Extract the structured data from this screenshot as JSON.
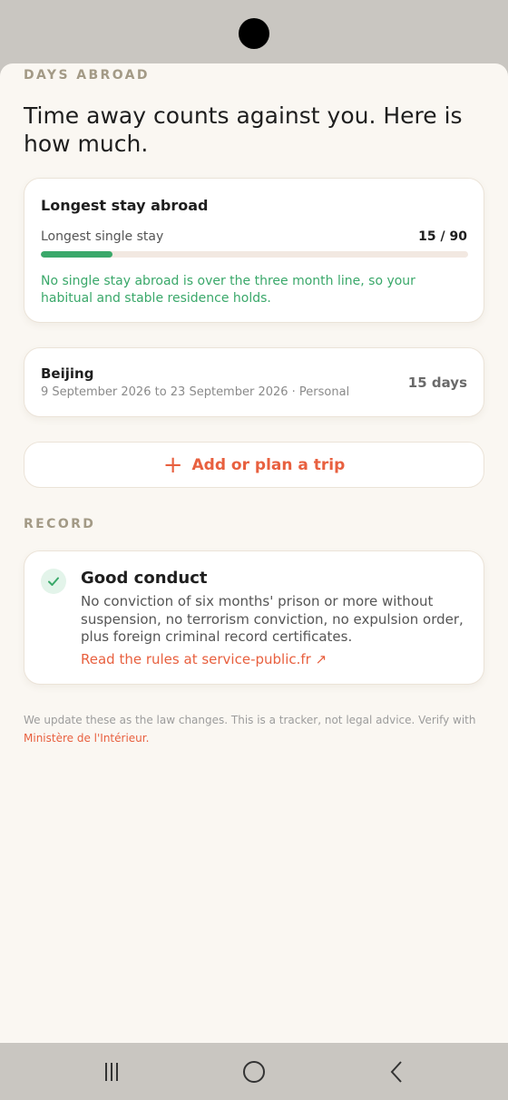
{
  "sections": {
    "days_abroad": "DAYS ABROAD",
    "record": "RECORD"
  },
  "headline": "Time away counts against you. Here is how much.",
  "longest_stay": {
    "title": "Longest stay abroad",
    "label": "Longest single stay",
    "count": "15 / 90",
    "progress_fraction": 0.1667,
    "note": "No single stay abroad is over the three month line, so your habitual and stable residence holds."
  },
  "trip": {
    "city": "Beijing",
    "dates": "9 September 2026 to 23 September 2026 · Personal",
    "duration": "15 days"
  },
  "add_trip": {
    "label": "Add or plan a trip",
    "icon": "plus-icon"
  },
  "conduct": {
    "title": "Good conduct",
    "description": "No conviction of six months' prison or more without suspension, no terrorism conviction, no expulsion order, plus foreign criminal record certificates.",
    "link": "Read the rules at service-public.fr ↗"
  },
  "disclaimer": {
    "text": "We update these as the law changes. This is a tracker, not legal advice. Verify with ",
    "link": "Ministère de l'Intérieur."
  },
  "colors": {
    "accent": "#e8603f",
    "success": "#3aa86a",
    "background": "#faf7f2",
    "label": "#a39a86"
  }
}
